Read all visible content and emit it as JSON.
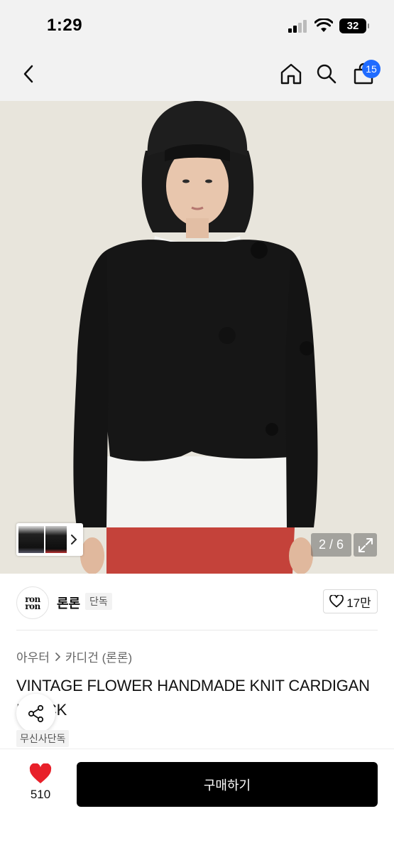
{
  "status_bar": {
    "time": "1:29",
    "battery": "32"
  },
  "nav": {
    "back_icon": "chevron-left-icon",
    "home_icon": "home-icon",
    "search_icon": "search-icon",
    "cart_icon": "shopping-bag-icon",
    "cart_badge": "15"
  },
  "gallery": {
    "counter": "2 / 6",
    "current_image": 2,
    "total_images": 6,
    "expand_icon": "expand-icon"
  },
  "brand": {
    "logo_text_top": "ron",
    "logo_text_bottom": "ron",
    "name": "론론",
    "tag": "단독",
    "likes": "17만"
  },
  "product": {
    "breadcrumb": [
      "아우터",
      "카디건 (론론)"
    ],
    "title": "VINTAGE FLOWER HANDMADE KNIT CARDIGAN BLACK",
    "tag": "무신사단독"
  },
  "bottom_bar": {
    "wish_count": "510",
    "buy_label": "구매하기"
  },
  "colors": {
    "accent_badge": "#1f6bff",
    "heart": "#e8202a",
    "buy_button": "#000000"
  }
}
